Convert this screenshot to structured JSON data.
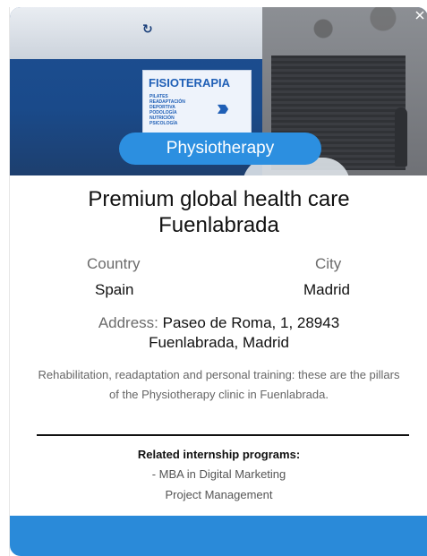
{
  "photo": {
    "sign_title": "FISIOTERAPIA",
    "sign_lines": [
      "PILATES",
      "READAPTACIÓN DEPORTIVA",
      "PODOLOGÍA",
      "NUTRICIÓN",
      "PSICOLOGÍA"
    ]
  },
  "category": "Physiotherapy",
  "title": "Premium global health care Fuenlabrada",
  "location": {
    "country_label": "Country",
    "country_value": "Spain",
    "city_label": "City",
    "city_value": "Madrid"
  },
  "address": {
    "label": "Address:",
    "value": "Paseo de Roma, 1, 28943 Fuenlabrada, Madrid"
  },
  "description": "Rehabilitation, readaptation and personal training: these are the pillars of the Physiotherapy clinic in Fuenlabrada.",
  "programs": {
    "heading": "Related internship programs:",
    "items": [
      "- MBA in Digital Marketing",
      "Project Management"
    ]
  },
  "colors": {
    "accent": "#2c8fe0",
    "footer": "#2a8ad9"
  }
}
